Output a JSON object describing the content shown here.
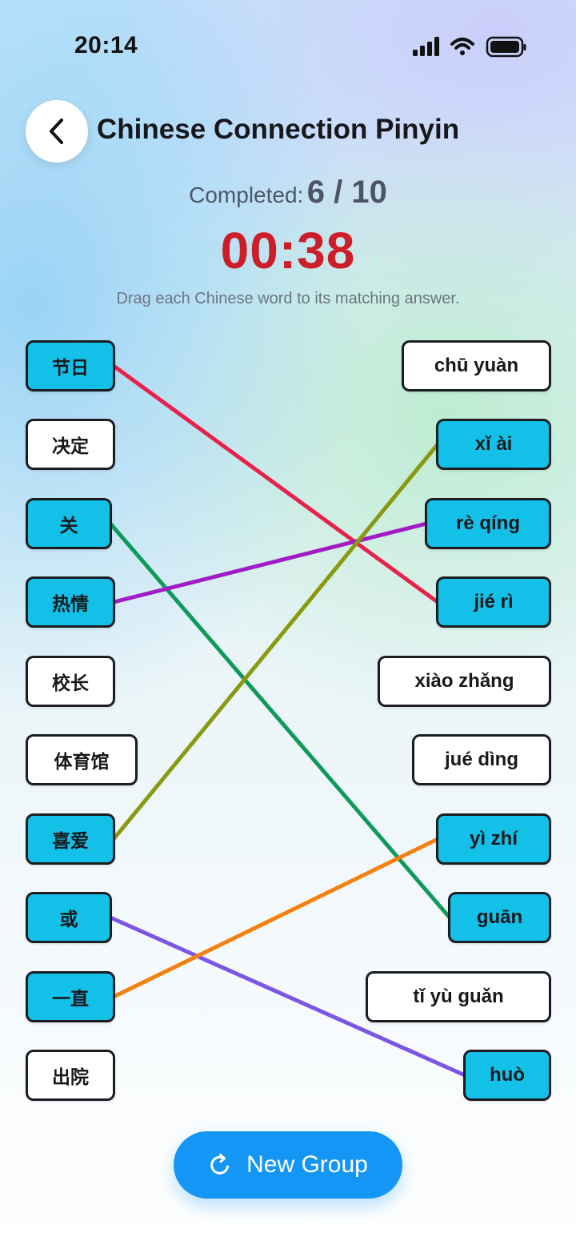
{
  "status_bar": {
    "time": "20:14",
    "icons": [
      "signal-icon",
      "wifi-icon",
      "battery-icon"
    ]
  },
  "header": {
    "back_icon": "chevron-left-icon",
    "title": "Chinese Connection Pinyin"
  },
  "progress": {
    "label": "Completed:",
    "value": "6 / 10",
    "completed": 6,
    "total": 10
  },
  "timer": "00:38",
  "instruction": "Drag each Chinese word to its matching answer.",
  "colors": {
    "matched_tile": "#12c0e8",
    "unmatched_tile": "#ffffff",
    "timer": "#cc1d28",
    "button": "#1396f5"
  },
  "words": [
    {
      "text": "节日",
      "matched": true
    },
    {
      "text": "决定",
      "matched": false
    },
    {
      "text": "关",
      "matched": true
    },
    {
      "text": "热情",
      "matched": true
    },
    {
      "text": "校长",
      "matched": false
    },
    {
      "text": "体育馆",
      "matched": false
    },
    {
      "text": "喜爱",
      "matched": true
    },
    {
      "text": "或",
      "matched": true
    },
    {
      "text": "一直",
      "matched": true
    },
    {
      "text": "出院",
      "matched": false
    }
  ],
  "answers": [
    {
      "text": "chū yuàn",
      "matched": false
    },
    {
      "text": "xǐ ài",
      "matched": true
    },
    {
      "text": "rè qíng",
      "matched": true
    },
    {
      "text": "jié rì",
      "matched": true
    },
    {
      "text": "xiào zhǎng",
      "matched": false
    },
    {
      "text": "jué dìng",
      "matched": false
    },
    {
      "text": "yì zhí",
      "matched": true
    },
    {
      "text": "guān",
      "matched": true
    },
    {
      "text": "tǐ yù guǎn",
      "matched": false
    },
    {
      "text": "huò",
      "matched": true
    }
  ],
  "connections": [
    {
      "word": "节日",
      "answer": "jié rì",
      "color": "#e8204a"
    },
    {
      "word": "关",
      "answer": "guān",
      "color": "#0f9a5a"
    },
    {
      "word": "热情",
      "answer": "rè qíng",
      "color": "#a21bc4"
    },
    {
      "word": "喜爱",
      "answer": "xǐ ài",
      "color": "#8a9a10"
    },
    {
      "word": "或",
      "answer": "huò",
      "color": "#7a55e6"
    },
    {
      "word": "一直",
      "answer": "yì zhí",
      "color": "#f5800e"
    }
  ],
  "new_group_button": {
    "icon": "refresh-icon",
    "label": "New Group"
  }
}
